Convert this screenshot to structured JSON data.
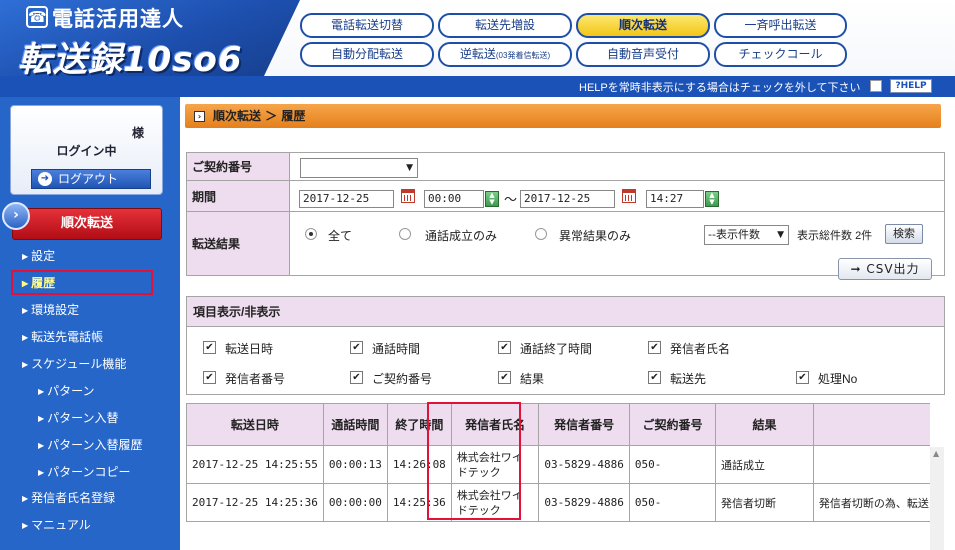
{
  "logo": {
    "line1": "電話活用達人",
    "line2": "転送録10so6"
  },
  "nav": {
    "row1": [
      "電話転送切替",
      "転送先増設",
      "順次転送",
      "一斉呼出転送"
    ],
    "row2": [
      "自動分配転送",
      "逆転送",
      "(03発着信転送)",
      "自動音声受付",
      "チェックコール"
    ],
    "active": "順次転送"
  },
  "help": {
    "text": "HELPを常時非表示にする場合はチェックを外して下さい",
    "button": "?HELP"
  },
  "sidebar": {
    "user_suffix": "様",
    "login_state": "ログイン中",
    "logout_label": "ログアウト",
    "section_title": "順次転送",
    "items": [
      "設定",
      "履歴",
      "環境設定",
      "転送先電話帳",
      "スケジュール機能",
      "パターン",
      "パターン入替",
      "パターン入替履歴",
      "パターンコピー",
      "発信者氏名登録",
      "マニュアル"
    ],
    "active_item": "履歴"
  },
  "breadcrumb": "順次転送 ＞ 履歴",
  "search_form": {
    "contract_label": "ご契約番号",
    "contract_value": "",
    "period_label": "期間",
    "date_from": "2017-12-25",
    "time_from": "00:00",
    "date_to": "2017-12-25",
    "time_to": "14:27",
    "result_label": "転送結果",
    "radio_options": [
      "全て",
      "通話成立のみ",
      "異常結果のみ"
    ],
    "radio_selected": "全て",
    "count_select": "--表示件数",
    "total_label": "表示総件数",
    "total_count": "2件",
    "search_button": "検索",
    "csv_button": "CSV出力"
  },
  "display_options": {
    "title": "項目表示/非表示",
    "checkboxes": [
      "転送日時",
      "通話時間",
      "通話終了時間",
      "発信者氏名",
      "発信者番号",
      "ご契約番号",
      "結果",
      "転送先",
      "処理No"
    ]
  },
  "table": {
    "headers": [
      "転送日時",
      "通話時間",
      "終了時間",
      "発信者氏名",
      "発信者番号",
      "ご契約番号",
      "結果",
      ""
    ],
    "rows": [
      [
        "2017-12-25 14:25:55",
        "00:00:13",
        "14:26:08",
        "株式会社ワイドテック",
        "03-5829-4886",
        "050-",
        "通話成立",
        ""
      ],
      [
        "2017-12-25 14:25:36",
        "00:00:00",
        "14:25:36",
        "株式会社ワイドテック",
        "03-5829-4886",
        "050-",
        "発信者切断",
        "発信者切断の為、転送"
      ]
    ]
  }
}
